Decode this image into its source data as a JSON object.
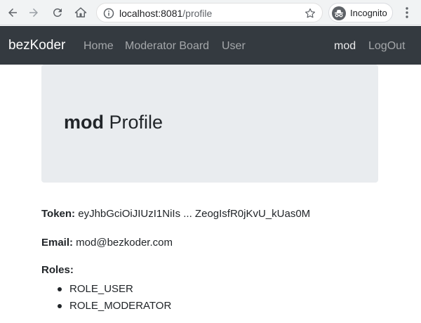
{
  "browser": {
    "url_host": "localhost:8081",
    "url_path": "/profile",
    "incognito_label": "Incognito",
    "icons": [
      "back-arrow-icon",
      "forward-arrow-icon",
      "reload-icon",
      "home-icon",
      "site-info-icon",
      "star-icon",
      "incognito-icon",
      "kebab-menu-icon"
    ]
  },
  "navbar": {
    "brand": "bezKoder",
    "links": [
      "Home",
      "Moderator Board",
      "User"
    ],
    "profile_link": "mod",
    "logout_link": "LogOut",
    "colors": {
      "background": "#343a40",
      "link": "rgba(255,255,255,0.55)"
    }
  },
  "jumbotron": {
    "username": "mod",
    "title_suffix": " Profile",
    "background": "#e9ecef"
  },
  "profile": {
    "token_label": "Token:",
    "token_value": " eyJhbGciOiJIUzI1NiIs ... ZeogIsfR0jKvU_kUas0M",
    "email_label": "Email:",
    "email_value": " mod@bezkoder.com",
    "roles_label": "Roles:",
    "roles": [
      "ROLE_USER",
      "ROLE_MODERATOR"
    ]
  }
}
